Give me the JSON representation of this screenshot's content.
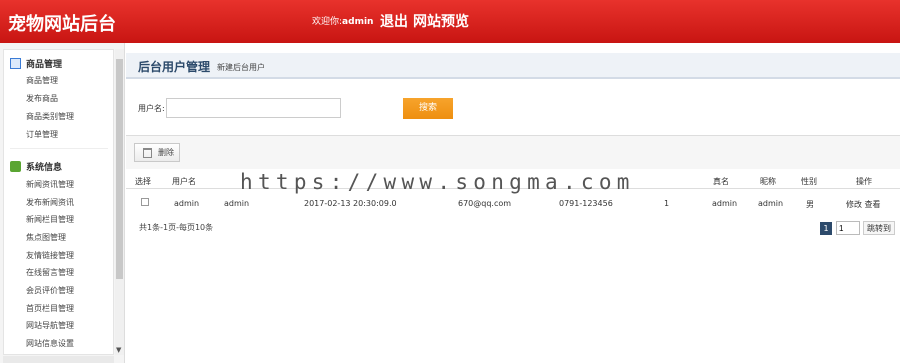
{
  "header": {
    "site_title": "宠物网站后台",
    "welcome_prefix": "欢迎你:",
    "username": "admin",
    "logout_label": "退出",
    "preview_label": "网站预览",
    "background_color": "#d4211c"
  },
  "sidebar": {
    "groups": [
      {
        "title": "商品管理",
        "icon": "goods-icon",
        "items": [
          "商品管理",
          "发布商品",
          "商品类别管理",
          "订单管理"
        ]
      },
      {
        "title": "系统信息",
        "icon": "system-icon",
        "items": [
          "新闻资讯管理",
          "发布新闻资讯",
          "新闻栏目管理",
          "焦点图管理",
          "友情链接管理",
          "在线留言管理",
          "会员评价管理",
          "首页栏目管理",
          "网站导航管理",
          "网站信息设置"
        ]
      }
    ]
  },
  "main": {
    "page_title": "后台用户管理",
    "page_subtitle": "新建后台用户",
    "search": {
      "label": "用户名:",
      "value": "",
      "button_label": "搜索"
    },
    "toolbar": {
      "delete_label": "删除"
    },
    "table": {
      "headers": [
        "选择",
        "用户名",
        "真名",
        "昵称",
        "性别",
        "操作"
      ],
      "rows": [
        {
          "username": "admin",
          "password": "admin",
          "created": "2017-02-13 20:30:09.0",
          "email": "670@qq.com",
          "phone": "0791-123456",
          "status": "1",
          "realname": "admin",
          "nickname": "admin",
          "gender": "男",
          "edit_label": "修改",
          "view_label": "查看"
        }
      ]
    },
    "pager": {
      "info": "共1条-1页-每页10条",
      "current_page": "1",
      "page_input": "1",
      "go_label": "跳转到"
    }
  },
  "watermark": "https://www.songma.com",
  "colors": {
    "accent": "#f39a1e",
    "title_text": "#2c4a6b"
  }
}
